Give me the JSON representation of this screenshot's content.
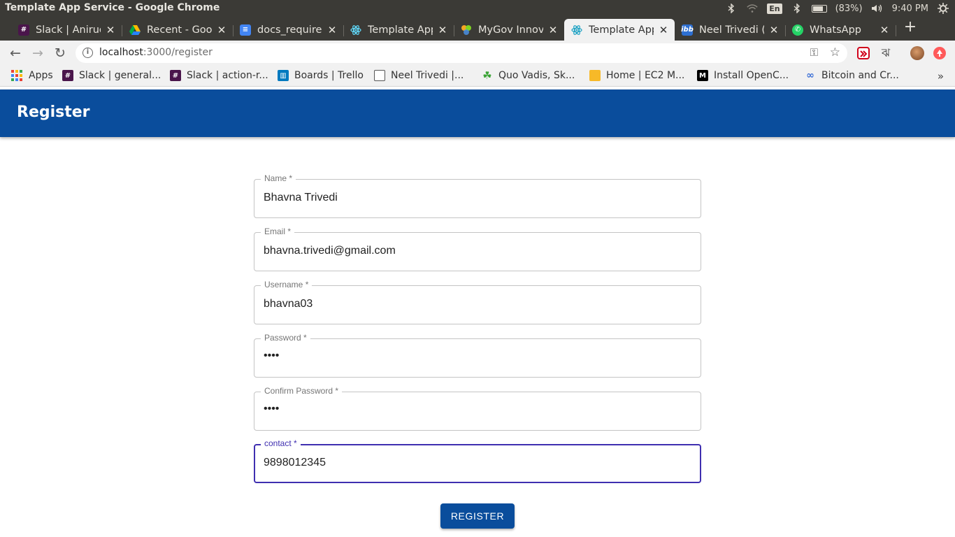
{
  "os": {
    "window_title": "Template App Service - Google Chrome",
    "lang": "En",
    "battery": "(83%)",
    "battery_level": 0.83,
    "time": "9:40 PM"
  },
  "tabs": [
    {
      "label": "Slack | Anirudh",
      "icon": "slack-icon",
      "active": false
    },
    {
      "label": "Recent - Google",
      "icon": "drive-icon",
      "active": false
    },
    {
      "label": "docs_required",
      "icon": "docs-icon",
      "active": false
    },
    {
      "label": "Template App",
      "icon": "react-icon",
      "active": false
    },
    {
      "label": "MyGov Innova",
      "icon": "mygov-icon",
      "active": false
    },
    {
      "label": "Template App",
      "icon": "react-icon",
      "active": true
    },
    {
      "label": "Neel Trivedi (n",
      "icon": "ibb-icon",
      "active": false
    },
    {
      "label": "WhatsApp",
      "icon": "whatsapp-icon",
      "active": false
    }
  ],
  "address": {
    "host": "localhost",
    "path": ":3000/register"
  },
  "bookmarks": [
    {
      "label": "Apps",
      "icon": "apps-grid-icon"
    },
    {
      "label": "Slack | general...",
      "icon": "slack-icon"
    },
    {
      "label": "Slack | action-r...",
      "icon": "slack-icon"
    },
    {
      "label": "Boards | Trello",
      "icon": "trello-icon"
    },
    {
      "label": "Neel Trivedi |...",
      "icon": "page-icon"
    },
    {
      "label": "Quo Vadis, Sk...",
      "icon": "leaf-icon"
    },
    {
      "label": "Home | EC2 M...",
      "icon": "box-icon"
    },
    {
      "label": "Install OpenC...",
      "icon": "medium-icon"
    },
    {
      "label": "Bitcoin and Cr...",
      "icon": "link-icon"
    }
  ],
  "app": {
    "title": "Register",
    "fields": {
      "name": {
        "label": "Name *",
        "value": "Bhavna Trivedi"
      },
      "email": {
        "label": "Email *",
        "value": "bhavna.trivedi@gmail.com"
      },
      "username": {
        "label": "Username *",
        "value": "bhavna03"
      },
      "password": {
        "label": "Password *",
        "value": "••••"
      },
      "confirm_password": {
        "label": "Confirm Password *",
        "value": "••••"
      },
      "contact": {
        "label": "contact *",
        "value": "9898012345"
      }
    },
    "register_label": "REGISTER"
  },
  "colors": {
    "primary": "#0a4d9c",
    "focus": "#3f2fb0"
  }
}
